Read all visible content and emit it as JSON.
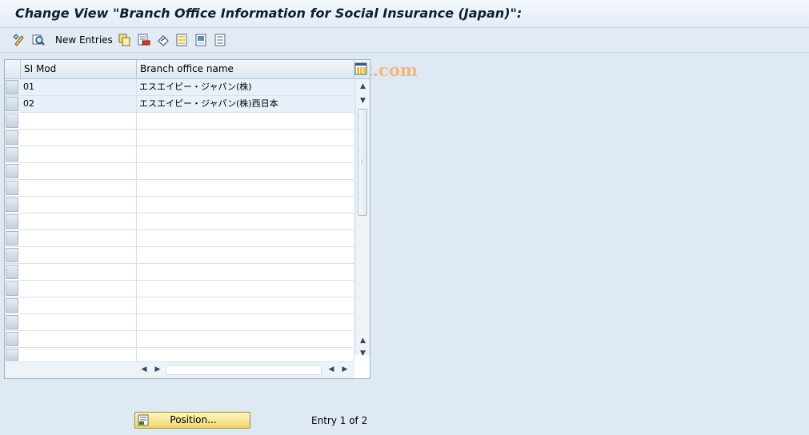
{
  "window": {
    "title": "Change View \"Branch Office Information for Social Insurance (Japan)\":"
  },
  "toolbar": {
    "new_entries_label": "New Entries",
    "watermark": "www.tutorialkart.com"
  },
  "table": {
    "columns": [
      "SI Mod",
      "Branch office name"
    ],
    "rows": [
      {
        "si_mod": "01",
        "branch_name": "エスエイピー・ジャパン(株)"
      },
      {
        "si_mod": "02",
        "branch_name": "エスエイピー・ジャパン(株)西日本"
      }
    ]
  },
  "footer": {
    "position_label": "Position...",
    "entry_info": "Entry 1 of 2"
  },
  "icons": {
    "toolbar": [
      "display-change-icon",
      "details-icon",
      "copy-icon",
      "delete-icon",
      "undo-icon",
      "select-all-icon",
      "select-block-icon",
      "deselect-all-icon"
    ],
    "table": [
      "column-settings-icon"
    ]
  },
  "colors": {
    "background": "#dfe9f3",
    "title_text": "#0d1f33",
    "position_button": "#f1d86a",
    "watermark": "#f3b06b",
    "row_filled": "#e8f1f9"
  }
}
